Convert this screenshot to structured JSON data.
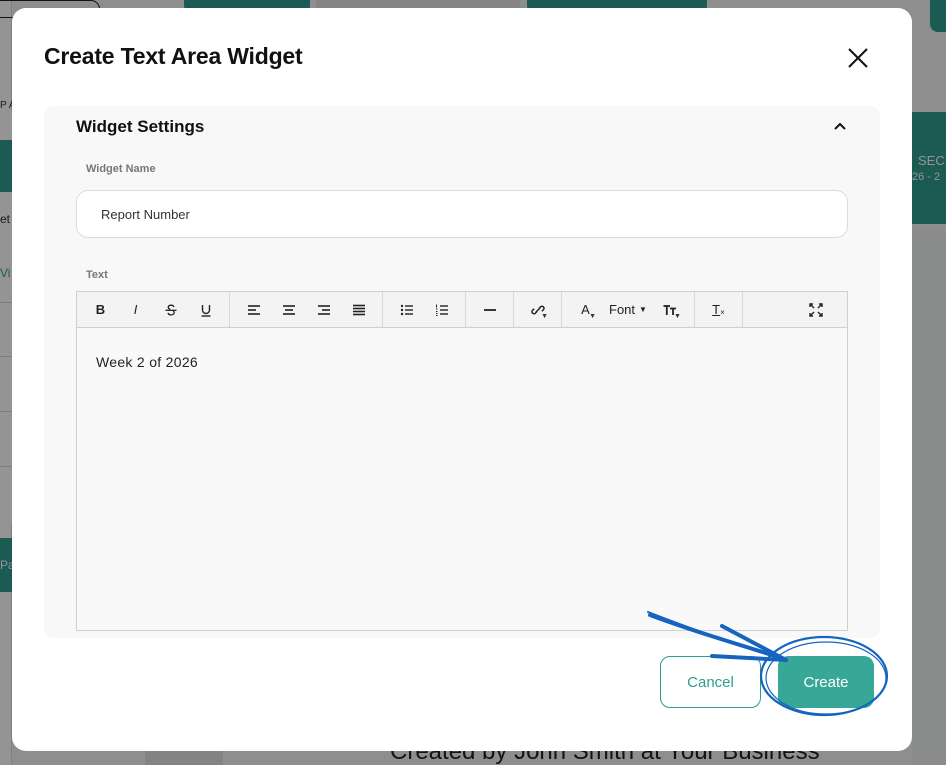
{
  "modal": {
    "title": "Create Text Area Widget",
    "section_title": "Widget Settings",
    "widget_name_label": "Widget Name",
    "widget_name_value": "Report Number",
    "text_label": "Text",
    "editor_content": "Week 2 of 2026",
    "toolbar": {
      "bold": "B",
      "italic": "I",
      "text_color": "A",
      "font": "Font",
      "clear_format": "T"
    },
    "cancel_label": "Cancel",
    "create_label": "Create"
  },
  "background": {
    "footer_text": "Created by John Smith at Your Business",
    "right_card_title": "SEC",
    "right_card_sub": "26 - 2",
    "left_frag_1": "P A",
    "left_frag_2": "et",
    "left_frag_3": "Vi",
    "left_frag_4": "Pa"
  },
  "colors": {
    "accent": "#37a898",
    "annotation": "#1565c0"
  }
}
